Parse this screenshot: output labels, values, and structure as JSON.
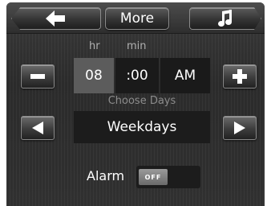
{
  "topbar": {
    "back_icon": "arrow-left-icon",
    "more_label": "More",
    "music_icon": "music-note-icon"
  },
  "time": {
    "hr_label": "hr",
    "min_label": "min",
    "hour": "08",
    "minute": ":00",
    "ampm": "AM",
    "decrement_icon": "minus-icon",
    "increment_icon": "plus-icon"
  },
  "days": {
    "title": "Choose Days",
    "value": "Weekdays",
    "prev_icon": "triangle-left-icon",
    "next_icon": "triangle-right-icon"
  },
  "alarm": {
    "label": "Alarm",
    "toggle_text": "OFF",
    "enabled": false
  },
  "colors": {
    "background": "#2f2f2f",
    "selected_field": "#5c5c5c",
    "field": "#1a1a1a",
    "label_muted": "#8c8c8c"
  }
}
